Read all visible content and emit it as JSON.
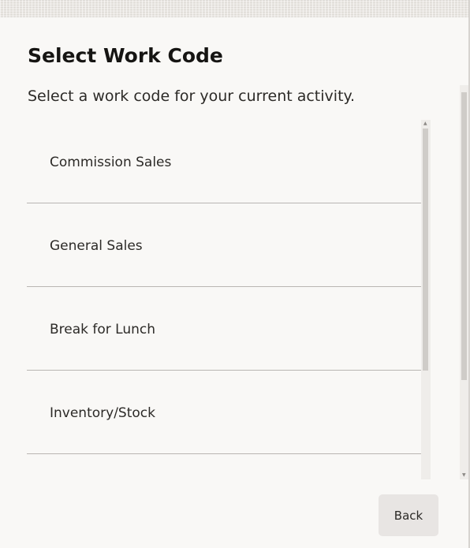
{
  "dialog": {
    "title": "Select Work Code",
    "subtitle": "Select a work code for your current activity."
  },
  "work_codes": [
    {
      "label": "Commission Sales"
    },
    {
      "label": "General Sales"
    },
    {
      "label": "Break for Lunch"
    },
    {
      "label": "Inventory/Stock"
    }
  ],
  "footer": {
    "back_label": "Back"
  },
  "colors": {
    "background": "#f9f8f6",
    "title_text": "#161513",
    "body_text": "#2c2a27",
    "divider": "#b9b6b2",
    "button_bg": "#e8e5e3",
    "scroll_thumb": "#cfccc8"
  },
  "icons": {
    "scroll_up": "triangle-up-icon",
    "scroll_down": "triangle-down-icon"
  }
}
